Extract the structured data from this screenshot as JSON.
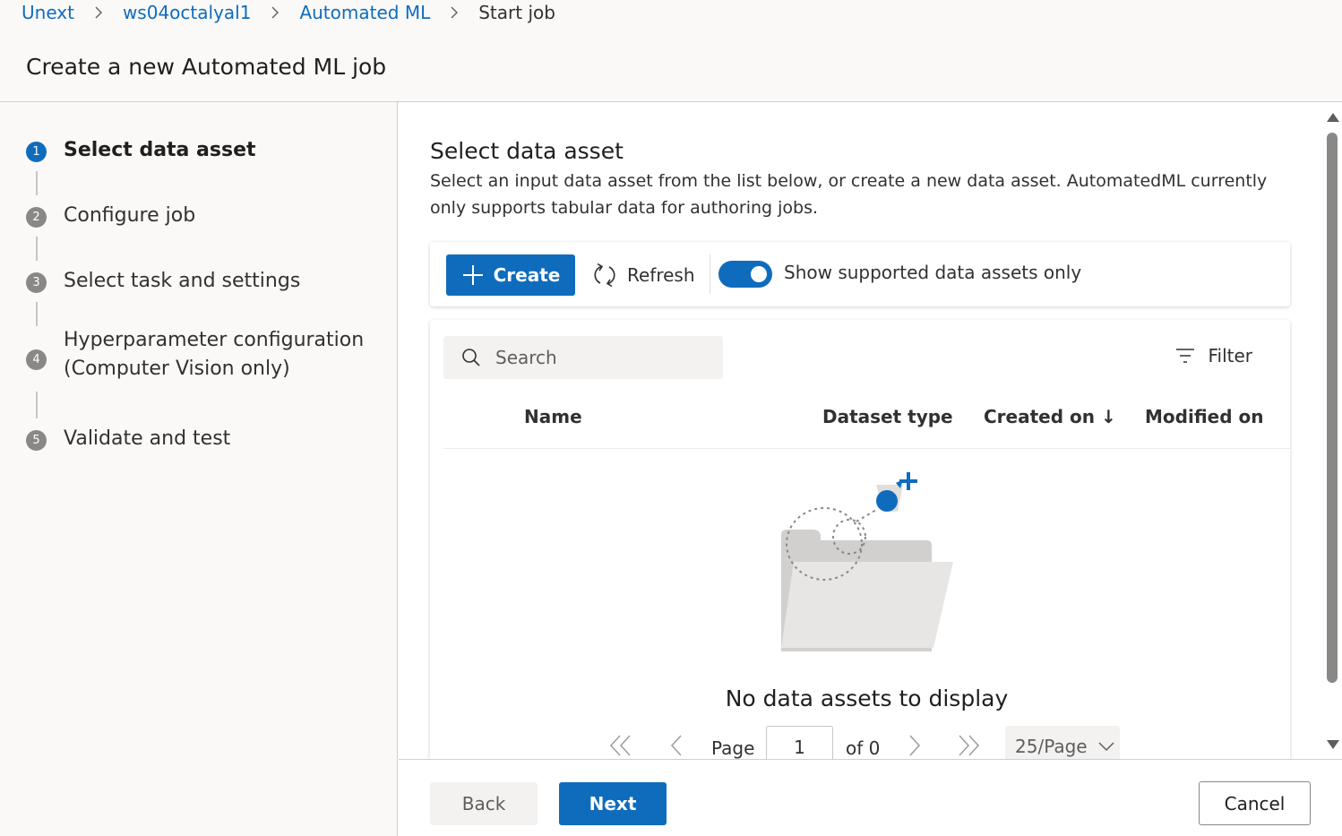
{
  "breadcrumb": {
    "items": [
      "Unext",
      "ws04octalyal1",
      "Automated ML"
    ],
    "current": "Start job"
  },
  "page_title": "Create a new Automated ML job",
  "wizard": {
    "steps": [
      {
        "num": "1",
        "label": "Select data asset",
        "active": true
      },
      {
        "num": "2",
        "label": "Configure job",
        "active": false
      },
      {
        "num": "3",
        "label": "Select task and settings",
        "active": false
      },
      {
        "num": "4",
        "label_line1": "Hyperparameter configuration",
        "label_line2": "(Computer Vision only)",
        "active": false
      },
      {
        "num": "5",
        "label": "Validate and test",
        "active": false
      }
    ]
  },
  "main": {
    "title": "Select data asset",
    "description": "Select an input data asset from the list below, or create a new data asset. AutomatedML currently only supports tabular data for authoring jobs.",
    "toolbar": {
      "create_label": "Create",
      "refresh_label": "Refresh",
      "toggle_label": "Show supported data assets only",
      "toggle_on": true
    },
    "search": {
      "placeholder": "Search",
      "value": ""
    },
    "filter_label": "Filter",
    "columns": [
      "Name",
      "Dataset type",
      "Created on ↓",
      "Modified on"
    ],
    "empty_message": "No data assets to display",
    "pager": {
      "page_label": "Page",
      "page_value": "1",
      "of_label": "of 0",
      "page_size": "25/Page"
    }
  },
  "footer": {
    "back_label": "Back",
    "next_label": "Next",
    "cancel_label": "Cancel"
  },
  "colors": {
    "accent": "#0f6cbd",
    "sidebar_bg": "#faf9f8",
    "step_inactive": "#8a8886"
  }
}
